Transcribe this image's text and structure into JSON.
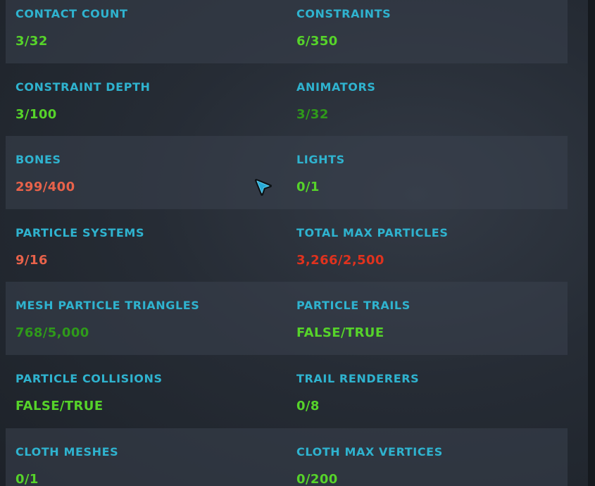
{
  "colors": {
    "label": "#2fb3cf",
    "ok": "#56d32a",
    "ok_dim": "#2f9a1a",
    "warn": "#e8624a",
    "error": "#e0321e"
  },
  "cursor": {
    "icon": "pointer-arrow-icon"
  },
  "stats": [
    {
      "label": "CONTACT COUNT",
      "value": "3/32",
      "status": "ok"
    },
    {
      "label": "CONSTRAINTS",
      "value": "6/350",
      "status": "ok"
    },
    {
      "label": "CONSTRAINT DEPTH",
      "value": "3/100",
      "status": "ok"
    },
    {
      "label": "ANIMATORS",
      "value": "3/32",
      "status": "ok_dim"
    },
    {
      "label": "BONES",
      "value": "299/400",
      "status": "warn"
    },
    {
      "label": "LIGHTS",
      "value": "0/1",
      "status": "ok"
    },
    {
      "label": "PARTICLE SYSTEMS",
      "value": "9/16",
      "status": "warn"
    },
    {
      "label": "TOTAL MAX PARTICLES",
      "value": "3,266/2,500",
      "status": "error"
    },
    {
      "label": "MESH PARTICLE TRIANGLES",
      "value": "768/5,000",
      "status": "ok_dim"
    },
    {
      "label": "PARTICLE TRAILS",
      "value": "FALSE/TRUE",
      "status": "ok"
    },
    {
      "label": "PARTICLE COLLISIONS",
      "value": "FALSE/TRUE",
      "status": "ok"
    },
    {
      "label": "TRAIL RENDERERS",
      "value": "0/8",
      "status": "ok"
    },
    {
      "label": "CLOTH MESHES",
      "value": "0/1",
      "status": "ok"
    },
    {
      "label": "CLOTH MAX VERTICES",
      "value": "0/200",
      "status": "ok"
    }
  ]
}
